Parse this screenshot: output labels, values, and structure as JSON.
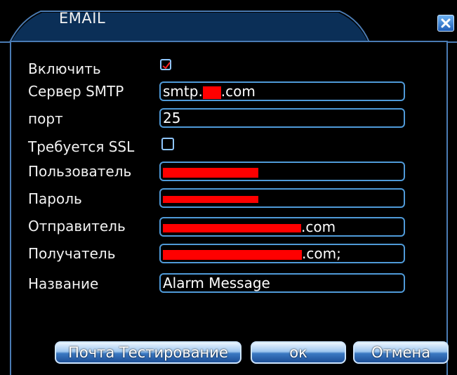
{
  "window": {
    "title": "EMAIL"
  },
  "form": {
    "enable_label": "Включить",
    "enable_checked": true,
    "smtp_label": "Сервер SMTP",
    "smtp_prefix": "smtp.",
    "smtp_suffix": ".com",
    "port_label": "порт",
    "port_value": "25",
    "ssl_label": "Требуется SSL",
    "ssl_checked": false,
    "user_label": "Пользователь",
    "password_label": "Пароль",
    "sender_label": "Отправитель",
    "sender_suffix": ".com",
    "receiver_label": "Получатель",
    "receiver_suffix": ".com;",
    "subject_label": "Название",
    "subject_value": "Alarm Message"
  },
  "buttons": {
    "test": "Почта Тестирование",
    "ok": "ок",
    "cancel": "Отмена"
  },
  "colors": {
    "border_blue": "#4f9ad8",
    "redaction": "#ff0000",
    "checkmark": "#ff2020"
  }
}
